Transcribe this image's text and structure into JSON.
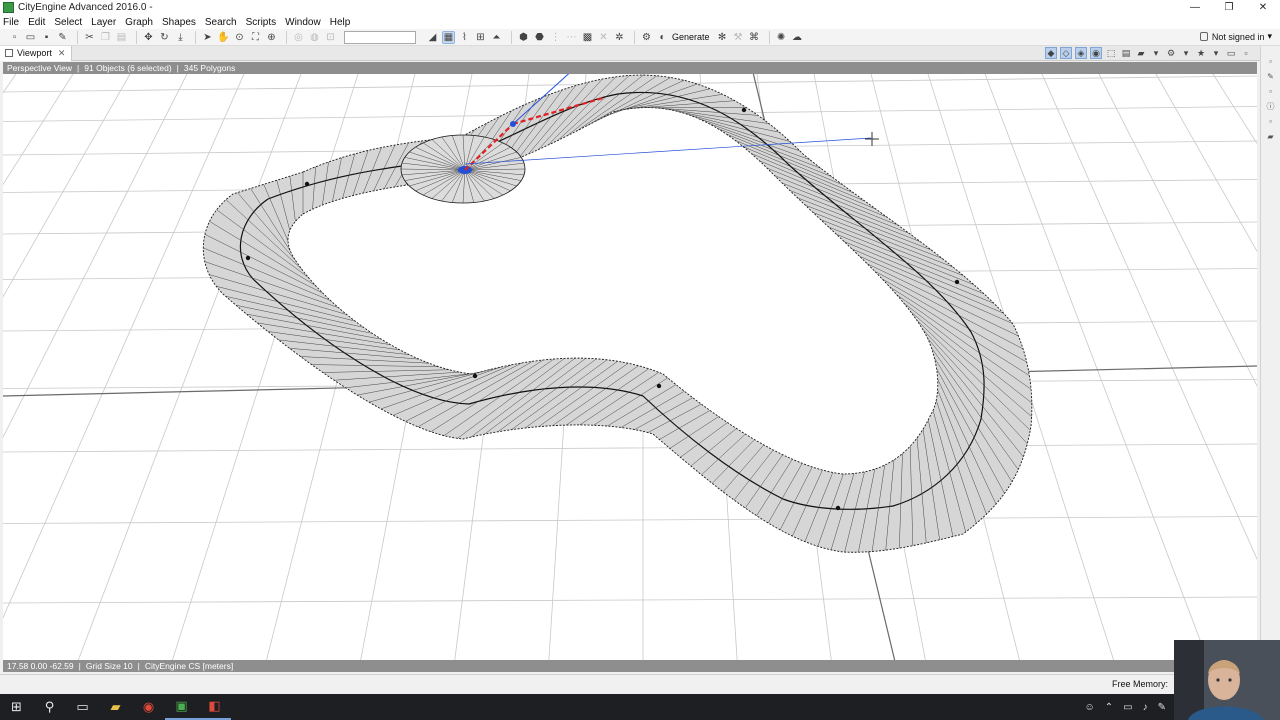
{
  "window": {
    "title": "CityEngine Advanced 2016.0 -",
    "controls": [
      "—",
      "❐",
      "✕"
    ]
  },
  "menu": [
    "File",
    "Edit",
    "Select",
    "Layer",
    "Graph",
    "Shapes",
    "Search",
    "Scripts",
    "Window",
    "Help"
  ],
  "toolbar": {
    "generate_label": "Generate",
    "search_value": "",
    "signin_label": "Not signed in"
  },
  "viewport": {
    "tab_label": "Viewport",
    "view_name": "Perspective View",
    "objects": "91 Objects (6 selected)",
    "polygons": "345 Polygons",
    "coords": "17.58 0.00 -62.59",
    "grid": "Grid Size 10",
    "cs": "CityEngine CS [meters]"
  },
  "status": {
    "free_memory_label": "Free Memory:"
  },
  "colors": {
    "road_fill": "#d4d4d4",
    "road_edge": "#1a1a1a",
    "grid": "#c8c8c8",
    "selection_red": "#e02020",
    "gizmo_blue": "#2250d8",
    "taskbar": "#1e1f22",
    "info_strip": "#8e8e8e"
  },
  "taskbar": {
    "items": [
      {
        "name": "windows-start-icon",
        "glyph": "⊞"
      },
      {
        "name": "search-icon",
        "glyph": "⚲"
      },
      {
        "name": "task-view-icon",
        "glyph": "▭"
      },
      {
        "name": "file-explorer-icon",
        "glyph": "▰"
      },
      {
        "name": "chrome-icon",
        "glyph": "◉"
      },
      {
        "name": "cityengine-icon",
        "glyph": "▣"
      },
      {
        "name": "recorder-icon",
        "glyph": "◧"
      }
    ]
  }
}
